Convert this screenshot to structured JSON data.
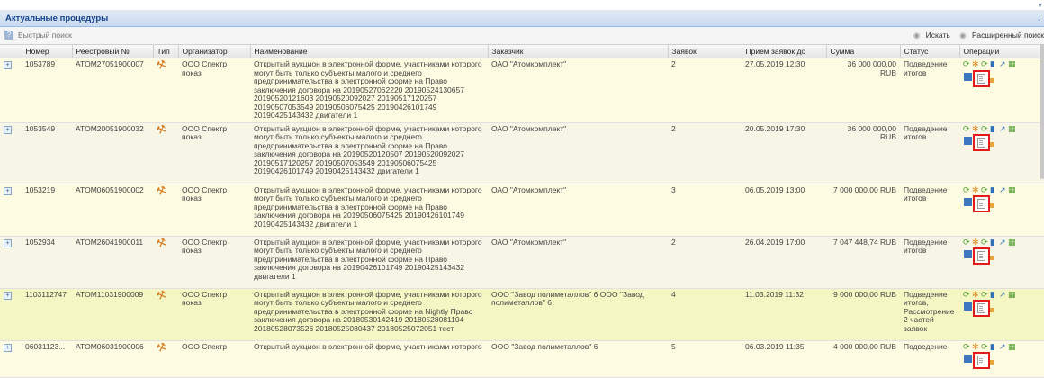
{
  "panel": {
    "title": "Актуальные процедуры"
  },
  "search": {
    "placeholder": "Быстрый поиск",
    "find_label": "Искать",
    "advanced_label": "Расширенный поиск"
  },
  "columns": [
    "Номер",
    "Реестровый №",
    "Тип",
    "Организатор",
    "Наименование",
    "Заказчик",
    "Заявок",
    "Прием заявок до",
    "Сумма",
    "Статус",
    "Операции"
  ],
  "rows": [
    {
      "number": "1053789",
      "registry": "ATOM27051900007",
      "organizer": "ООО Спектр показ",
      "name": "Открытый аукцион в электронной форме, участниками которого могут быть только субъекты малого и среднего предпринимательства в электронной форме на Право заключения договора на 20190527062220 20190524130657 20190520121603 20190520092027 20190517120257 20190507053549 20190506075425 20190426101749 20190425143432 двигатели 1",
      "customer": "ОАО \"Атомкомплект\"",
      "bids": "2",
      "deadline": "27.05.2019 12:30",
      "sum": "36 000 000,00 RUB",
      "status": "Подведение итогов"
    },
    {
      "number": "1053549",
      "registry": "ATOM20051900032",
      "organizer": "ООО Спектр показ",
      "name": "Открытый аукцион в электронной форме, участниками которого могут быть только субъекты малого и среднего предпринимательства в электронной форме на Право заключения договора на 20190520120507 20190520092027 20190517120257 20190507053549 20190506075425 20190426101749 20190425143432 двигатели 1",
      "customer": "ОАО \"Атомкомплект\"",
      "bids": "2",
      "deadline": "20.05.2019 17:30",
      "sum": "36 000 000,00 RUB",
      "status": "Подведение итогов"
    },
    {
      "number": "1053219",
      "registry": "ATOM06051900002",
      "organizer": "ООО Спектр показ",
      "name": "Открытый аукцион в электронной форме, участниками которого могут быть только субъекты малого и среднего предпринимательства в электронной форме на Право заключения договора на 20190506075425 20190426101749 20190425143432 двигатели 1",
      "customer": "ОАО \"Атомкомплект\"",
      "bids": "3",
      "deadline": "06.05.2019 13:00",
      "sum": "7 000 000,00 RUB",
      "status": "Подведение итогов"
    },
    {
      "number": "1052934",
      "registry": "ATOM26041900011",
      "organizer": "ООО Спектр показ",
      "name": "Открытый аукцион в электронной форме, участниками которого могут быть только субъекты малого и среднего предпринимательства в электронной форме на Право заключения договора на 20190426101749 20190425143432 двигатели 1",
      "customer": "ОАО \"Атомкомплект\"",
      "bids": "2",
      "deadline": "26.04.2019 17:00",
      "sum": "7 047 448,74 RUB",
      "status": "Подведение итогов"
    },
    {
      "number": "1103112747",
      "registry": "ATOM11031900009",
      "organizer": "ООО Спектр показ",
      "name": "Открытый аукцион в электронной форме, участниками которого могут быть только субъекты малого и среднего предпринимательства в электронной форме на Nightly Право заключения договора на 20180530142419 20180528081104 20180528073526 20180525080437 20180525072051 тест",
      "customer": "ООО \"Завод полиметаллов\" 6 ООО \"Завод полиметаллов\" 6",
      "bids": "4",
      "deadline": "11.03.2019 11:32",
      "sum": "9 000 000,00 RUB",
      "status": "Подведение итогов, Рассмотрение 2 частей заявок"
    },
    {
      "number": "06031123...",
      "registry": "ATOM06031900006",
      "organizer": "ООО Спектр",
      "name": "Открытый аукцион в электронной форме, участниками которого",
      "customer": "ООО \"Завод полиметаллов\" 6",
      "bids": "5",
      "deadline": "06.03.2019 11:35",
      "sum": "4 000 000,00 RUB",
      "status": "Подведение"
    }
  ]
}
